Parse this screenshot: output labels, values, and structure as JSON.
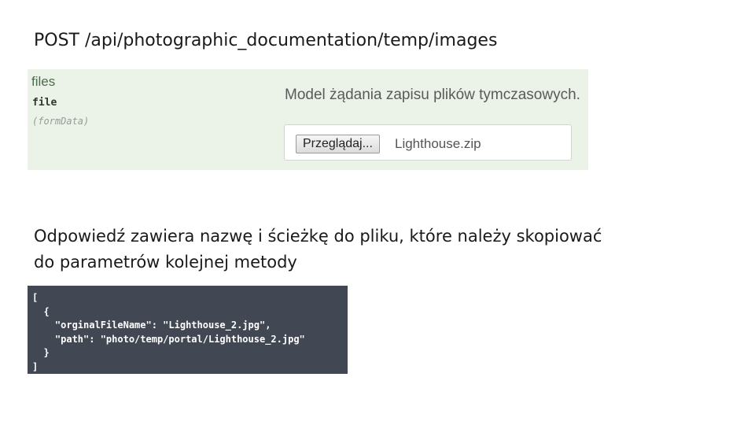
{
  "heading": "POST /api/photographic_documentation/temp/images",
  "parameter": {
    "name": "files",
    "type": "file",
    "location": "(formData)",
    "description": "Model żądania zapisu plików tymczasowych.",
    "browse_label": "Przeglądaj...",
    "selected_file": "Lighthouse.zip"
  },
  "description_lines": [
    "Odpowiedź zawiera nazwę i ścieżkę do pliku, które należy skopiować",
    "do parametrów kolejnej metody"
  ],
  "response_code": [
    "[",
    "  {",
    "    \"orginalFileName\": \"Lighthouse_2.jpg\",",
    "    \"path\": \"photo/temp/portal/Lighthouse_2.jpg\"",
    "  }",
    "]"
  ],
  "colors": {
    "panel_bg": "#ebf3e8",
    "code_bg": "#414853"
  }
}
